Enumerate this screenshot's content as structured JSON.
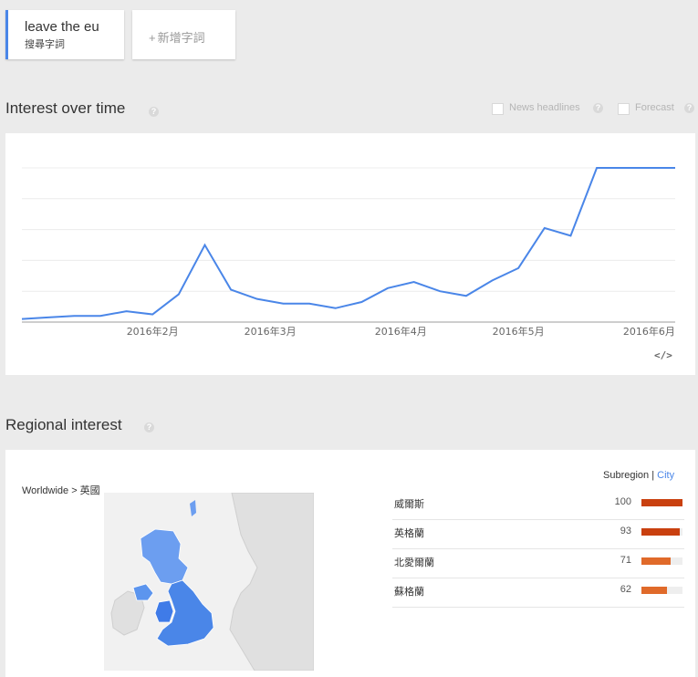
{
  "search_terms": {
    "term": "leave the eu",
    "term_sub": "搜尋字詞",
    "add_label": "新增字詞",
    "add_plus": "+"
  },
  "interest_over_time": {
    "title": "Interest over time",
    "help": "?",
    "news_headlines_label": "News headlines",
    "forecast_label": "Forecast",
    "embed_label": "</>"
  },
  "chart_data": {
    "type": "line",
    "title": "",
    "xlabel": "",
    "ylabel": "",
    "x_tick_labels": [
      "2016年2月",
      "2016年3月",
      "2016年4月",
      "2016年5月",
      "2016年6月"
    ],
    "x_ticks_at": [
      5,
      9.5,
      14.5,
      19,
      24
    ],
    "ylim": [
      0,
      100
    ],
    "grid": true,
    "series": [
      {
        "color": "#4a86e8",
        "x": [
          0,
          1,
          2,
          3,
          4,
          5,
          6,
          7,
          8,
          9,
          10,
          11,
          12,
          13,
          14,
          15,
          16,
          17,
          18,
          19,
          20,
          21,
          22,
          23,
          24,
          25
        ],
        "values": [
          2,
          3,
          4,
          4,
          7,
          5,
          18,
          50,
          21,
          15,
          12,
          12,
          9,
          13,
          22,
          26,
          20,
          17,
          27,
          35,
          61,
          56,
          100,
          100,
          100,
          100
        ]
      }
    ]
  },
  "regional_interest": {
    "title": "Regional interest",
    "help": "?",
    "breadcrumb": "Worldwide > 英國",
    "toggle_subregion": "Subregion",
    "toggle_separator": "|",
    "toggle_city": "City",
    "rows": [
      {
        "name": "威爾斯",
        "value": 100,
        "fraction": 1.0,
        "color": "#c9400f"
      },
      {
        "name": "英格蘭",
        "value": 93,
        "fraction": 0.93,
        "color": "#c9400f"
      },
      {
        "name": "北愛爾蘭",
        "value": 71,
        "fraction": 0.71,
        "color": "#e06a2a"
      },
      {
        "name": "蘇格蘭",
        "value": 62,
        "fraction": 0.62,
        "color": "#e06a2a"
      }
    ]
  }
}
